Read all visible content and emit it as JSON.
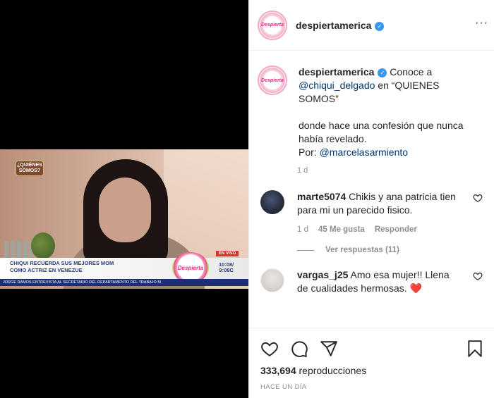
{
  "video": {
    "show_logo": "¿QUIÉNES SOMOS?",
    "live_badge": "EN VIVO",
    "headline_line1": "CHIQUI RECUERDA SUS MEJORES MOM",
    "headline_line2": "COMO ACTRIZ EN VENEZUE",
    "brand": "Despierta",
    "time_top": "10:08/",
    "time_bottom": "9:08C",
    "ticker": "JORGE RAMOS ENTREVISTA AL SECRETARIO DEL DEPARTAMENTO DEL TRABAJO M"
  },
  "header": {
    "username": "despiertamerica",
    "avatar_text": "Despierta",
    "more": "···"
  },
  "caption": {
    "username": "despiertamerica",
    "text_a": " Conoce a ",
    "mention1": "@chiqui_delgado",
    "text_b": " en “QUIENES SOMOS”",
    "line2": "donde hace una confesión que nunca había revelado.",
    "por": "Por: ",
    "mention2": "@marcelasarmiento",
    "time": "1 d"
  },
  "comments": [
    {
      "username": "marte5074",
      "text": "Chikis y ana patricia tien para mi un parecido fisico.",
      "time": "1 d",
      "likes": "45 Me gusta",
      "reply": "Responder",
      "view_replies": "Ver respuestas (11)"
    },
    {
      "username": "vargas_j25",
      "text": "Amo esa mujer!! Llena de cualidades hermosas.",
      "emoji": "❤️"
    }
  ],
  "stats": {
    "views_count": "333,694",
    "views_label": " reproducciones",
    "posted": "HACE UN DÍA"
  },
  "icons": {
    "like": "heart-icon",
    "comment": "comment-icon",
    "share": "share-icon",
    "save": "bookmark-icon",
    "verified": "verified-badge-icon"
  },
  "colors": {
    "link": "#00376b",
    "verified": "#3897f0",
    "muted": "#8e8e8e",
    "heart": "#ed4956"
  }
}
